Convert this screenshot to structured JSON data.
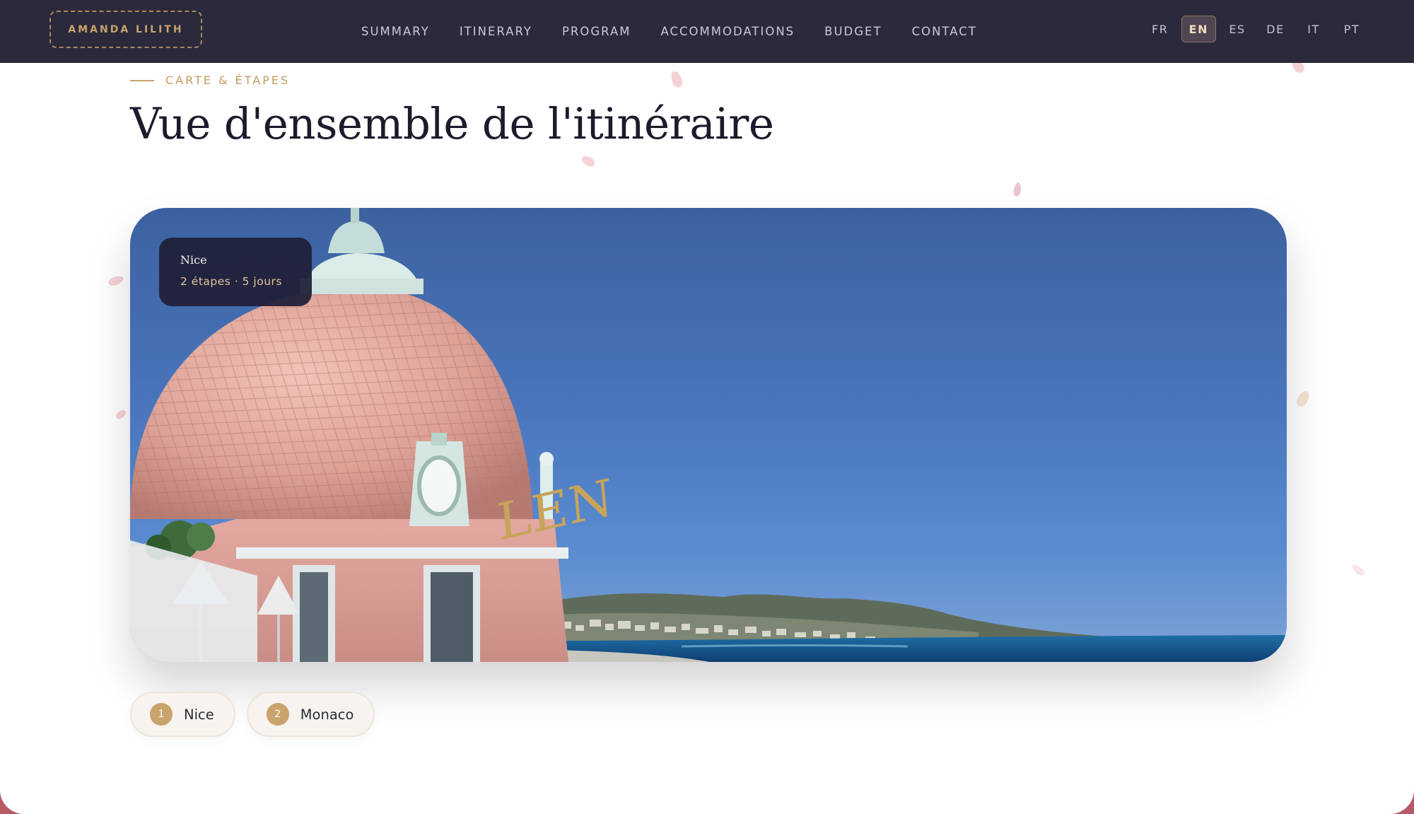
{
  "header": {
    "logo": "AMANDA LILITH",
    "nav": [
      "SUMMARY",
      "ITINERARY",
      "PROGRAM",
      "ACCOMMODATIONS",
      "BUDGET",
      "CONTACT"
    ],
    "languages": [
      "FR",
      "EN",
      "ES",
      "DE",
      "IT",
      "PT"
    ],
    "active_language": "EN"
  },
  "section": {
    "eyebrow": "CARTE & ÉTAPES",
    "title": "Vue d'ensemble de l'itinéraire"
  },
  "hero": {
    "city": "Nice",
    "meta": "2 étapes · 5 jours",
    "sign_text": "LEN"
  },
  "stops": [
    {
      "number": "1",
      "name": "Nice"
    },
    {
      "number": "2",
      "name": "Monaco"
    }
  ],
  "colors": {
    "header_bg": "#2a2a3c",
    "accent_gold": "#c9a36b",
    "title": "#1b1b2b",
    "badge_bg": "#202038",
    "frame": "#b85a66"
  }
}
